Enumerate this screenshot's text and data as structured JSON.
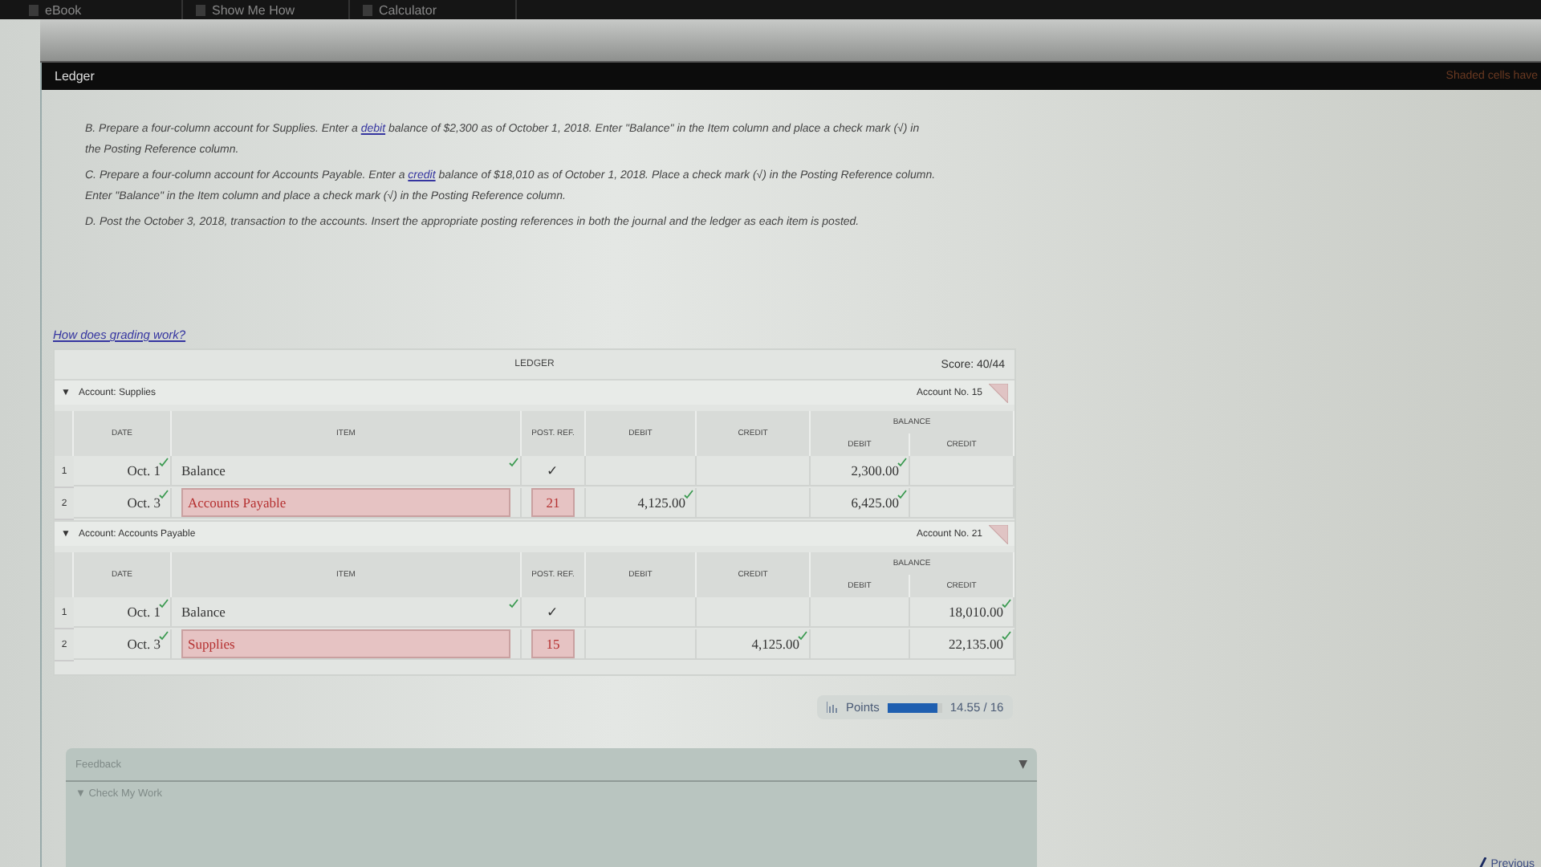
{
  "top_tabs": [
    {
      "label": "eBook"
    },
    {
      "label": "Show Me How"
    },
    {
      "label": "Calculator"
    }
  ],
  "panel": {
    "title": "Ledger",
    "note": "Shaded cells have"
  },
  "instructions": [
    {
      "before": "B. Prepare a four-column account for Supplies. Enter a ",
      "link": "debit",
      "after": " balance of $2,300 as of October 1, 2018. Enter \"Balance\" in the Item column and place a check mark (√) in the Posting Reference column."
    },
    {
      "before": "C. Prepare a four-column account for Accounts Payable. Enter a ",
      "link": "credit",
      "after": " balance of $18,010 as of October 1, 2018. Place a check mark (√) in the Posting Reference column. Enter \"Balance\" in the Item column and place a check mark (√) in the Posting Reference column."
    },
    {
      "before": "D. Post the October 3, 2018, transaction to the accounts. Insert the appropriate posting references in both the journal and the ledger as each item is posted."
    }
  ],
  "grading_link": "How does grading work?",
  "ledger": {
    "title": "LEDGER",
    "score": "Score: 40/44",
    "accounts": [
      {
        "caret": "▼",
        "label": "Account:  Supplies",
        "number": "Account No.  15",
        "columns": {
          "date": "DATE",
          "item": "ITEM",
          "post_ref": "POST. REF.",
          "debit": "DEBIT",
          "credit": "CREDIT",
          "balance": "BALANCE",
          "balance_debit": "DEBIT",
          "balance_credit": "CREDIT"
        },
        "rows": [
          {
            "num": "1",
            "date": {
              "text": "Oct. 1",
              "correct": true,
              "error": false
            },
            "item": {
              "text": "Balance",
              "correct": true,
              "error": false
            },
            "post_ref": {
              "text": "✓",
              "correct": false,
              "error": false
            },
            "balance_debit": {
              "text": "2,300.00",
              "correct": true,
              "error": false
            }
          },
          {
            "num": "2",
            "date": {
              "text": "Oct. 3",
              "correct": true,
              "error": false
            },
            "item": {
              "text": "Accounts Payable",
              "correct": false,
              "error": true
            },
            "post_ref": {
              "text": "21",
              "correct": false,
              "error": true
            },
            "debit": {
              "text": "4,125.00",
              "correct": true,
              "error": false
            },
            "balance_debit": {
              "text": "6,425.00",
              "correct": true,
              "error": false
            }
          }
        ]
      },
      {
        "caret": "▼",
        "label": "Account:  Accounts Payable",
        "number": "Account No.  21",
        "columns": {
          "date": "DATE",
          "item": "ITEM",
          "post_ref": "POST. REF.",
          "debit": "DEBIT",
          "credit": "CREDIT",
          "balance": "BALANCE",
          "balance_debit": "DEBIT",
          "balance_credit": "CREDIT"
        },
        "rows": [
          {
            "num": "1",
            "date": {
              "text": "Oct. 1",
              "correct": true,
              "error": false
            },
            "item": {
              "text": "Balance",
              "correct": true,
              "error": false
            },
            "post_ref": {
              "text": "✓",
              "correct": false,
              "error": false
            },
            "balance_credit": {
              "text": "18,010.00",
              "correct": true,
              "error": false
            }
          },
          {
            "num": "2",
            "date": {
              "text": "Oct. 3",
              "correct": true,
              "error": false
            },
            "item": {
              "text": "Supplies",
              "correct": false,
              "error": true
            },
            "post_ref": {
              "text": "15",
              "correct": false,
              "error": true
            },
            "credit": {
              "text": "4,125.00",
              "correct": true,
              "error": false
            },
            "balance_credit": {
              "text": "22,135.00",
              "correct": true,
              "error": false
            }
          }
        ]
      }
    ]
  },
  "points": {
    "label": "Points",
    "level": 0.91,
    "reading": "14.55 / 16"
  },
  "feedback": {
    "title": "Feedback",
    "caret": "▼",
    "section": "▼ Check My Work"
  },
  "footer": {
    "previous": "Previous"
  }
}
